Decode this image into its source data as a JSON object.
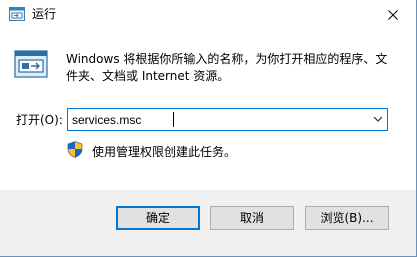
{
  "window": {
    "title": "运行"
  },
  "dialog": {
    "description": "Windows 将根据你所输入的名称，为你打开相应的程序、文件夹、文档或 Internet 资源。",
    "open_label": "打开(O):",
    "open_value": "services.msc",
    "admin_note": "使用管理权限创建此任务。"
  },
  "buttons": {
    "ok": "确定",
    "cancel": "取消",
    "browse": "浏览(B)..."
  },
  "icons": {
    "title": "run-app-icon",
    "run": "run-app-icon",
    "shield": "uac-shield-icon",
    "close": "close-icon",
    "dropdown": "chevron-down-icon"
  },
  "colors": {
    "accent": "#0078d7",
    "footer_bg": "#f0f0f0",
    "button_bg": "#e1e1e1"
  }
}
